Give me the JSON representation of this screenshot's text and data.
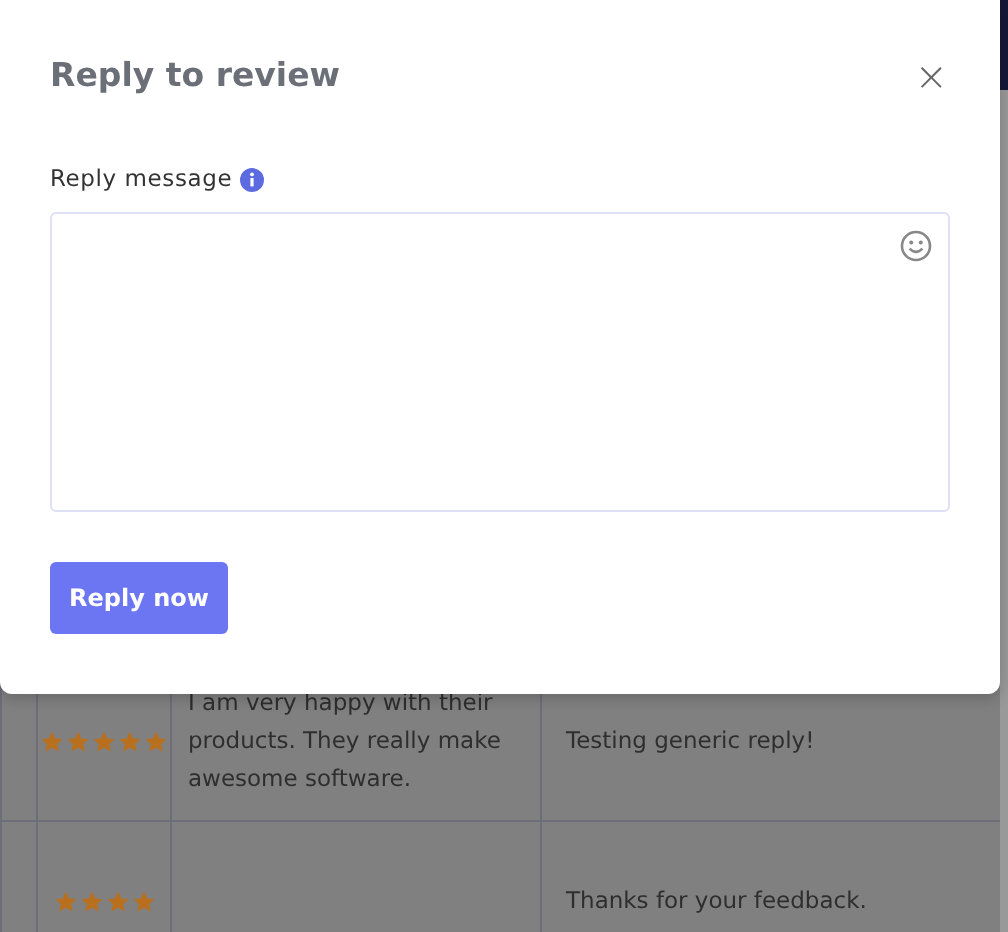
{
  "dialog": {
    "title": "Reply to review",
    "close": "×",
    "field_label": "Reply message",
    "button": "Reply now"
  },
  "reviews": [
    {
      "stars": 5,
      "review": "I am very happy with their products. They really make awesome software.",
      "reply": "Testing generic reply!"
    },
    {
      "stars": 4,
      "reply": "Thanks for your feedback."
    }
  ]
}
